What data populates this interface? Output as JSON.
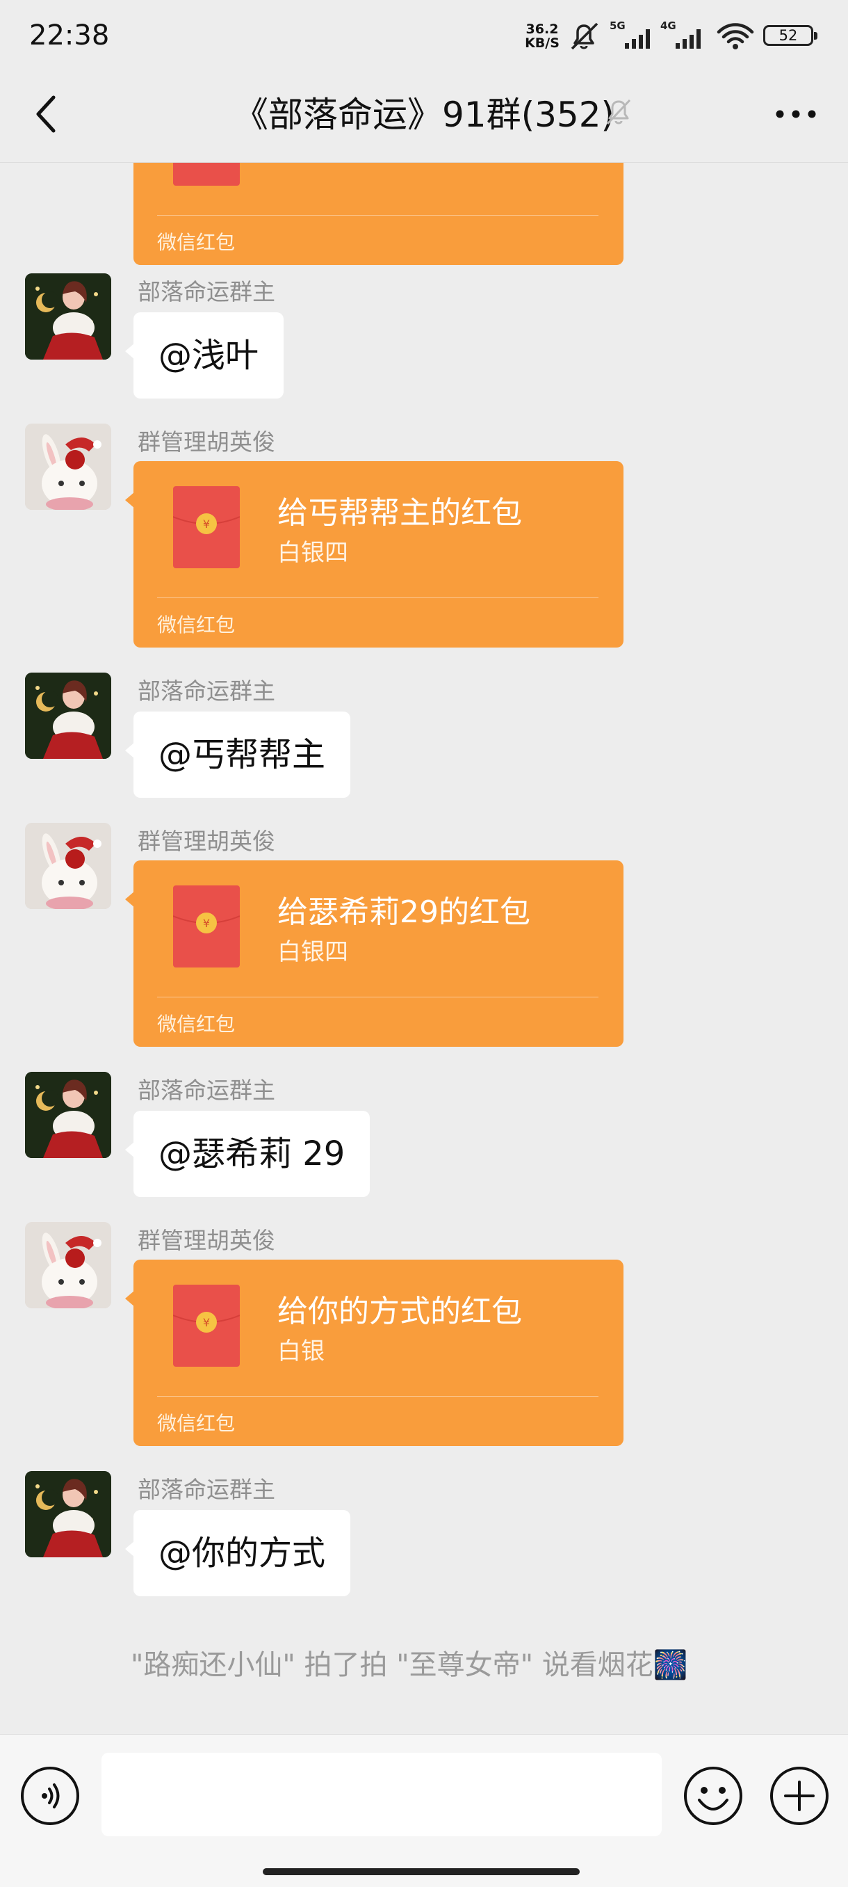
{
  "status_bar": {
    "time": "22:38",
    "net_speed_value": "36.2",
    "net_speed_unit": "KB/S",
    "net1": "5G",
    "net2": "4G",
    "battery": "52"
  },
  "header": {
    "title": "《部落命运》91群(352)",
    "back_icon": "chevron-left-icon",
    "mute_icon": "bell-off-icon",
    "more_icon": "more-horizontal-icon"
  },
  "messages": [
    {
      "type": "red_packet_partial",
      "footer": "微信红包"
    },
    {
      "sender": "部落命运群主",
      "type": "text",
      "text": "@浅叶"
    },
    {
      "sender": "群管理胡英俊",
      "type": "red_packet",
      "title": "给丐帮帮主的红包",
      "subtitle": "白银四",
      "footer": "微信红包"
    },
    {
      "sender": "部落命运群主",
      "type": "text",
      "text": "@丐帮帮主"
    },
    {
      "sender": "群管理胡英俊",
      "type": "red_packet",
      "title": "给瑟希莉29的红包",
      "subtitle": "白银四",
      "footer": "微信红包"
    },
    {
      "sender": "部落命运群主",
      "type": "text",
      "text": "@瑟希莉 29"
    },
    {
      "sender": "群管理胡英俊",
      "type": "red_packet",
      "title": "给你的方式的红包",
      "subtitle": "白银",
      "footer": "微信红包"
    },
    {
      "sender": "部落命运群主",
      "type": "text",
      "text": "@你的方式"
    }
  ],
  "system_message": "\"路痴还小仙\" 拍了拍 \"至尊女帝\" 说看烟花🎆",
  "input_bar": {
    "voice_icon": "voice-icon",
    "message_value": "",
    "emoji_icon": "emoji-icon",
    "plus_icon": "plus-icon"
  },
  "colors": {
    "background": "#ededed",
    "red_packet": "#f99d3c",
    "envelope": "#e9504a",
    "coin": "#f6c343"
  }
}
